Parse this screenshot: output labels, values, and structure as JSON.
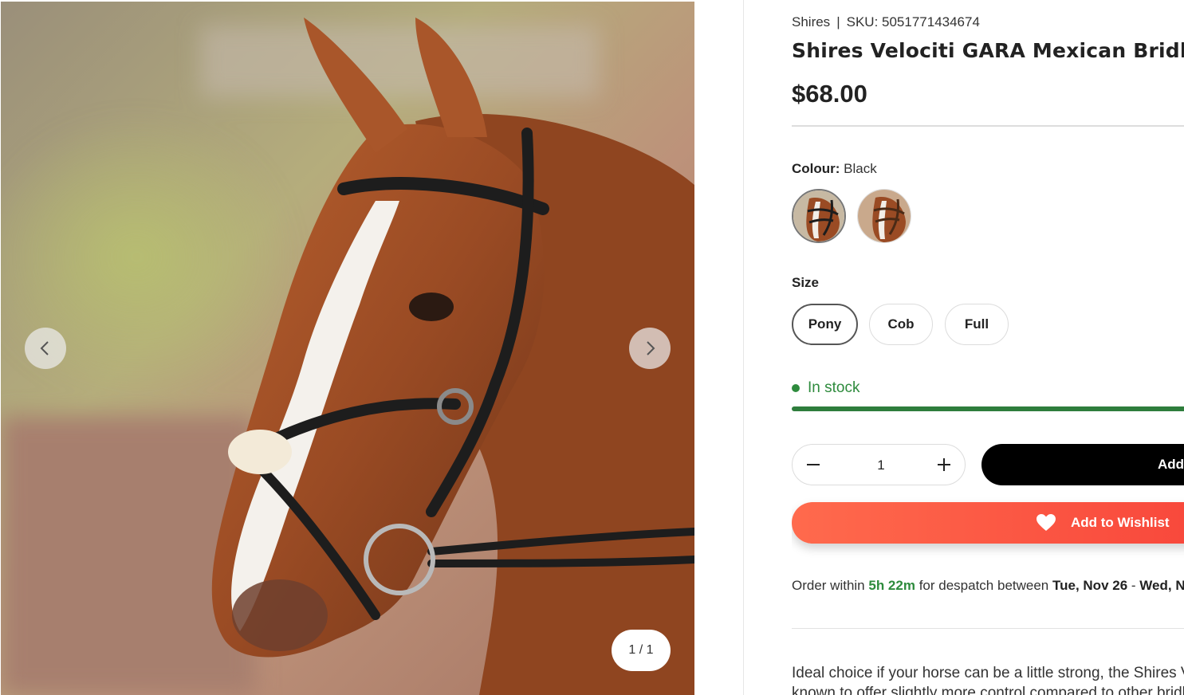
{
  "gallery": {
    "image_alt": "Chestnut horse wearing the Shires Velociti GARA Mexican Bridle",
    "counter": "1 / 1",
    "prev_icon": "chevron-left-icon",
    "next_icon": "chevron-right-icon"
  },
  "product": {
    "brand": "Shires",
    "separator": "|",
    "sku": "SKU: 5051771434674",
    "title": "Shires Velociti GARA Mexican Bridle",
    "price": "$68.00"
  },
  "colour": {
    "label": "Colour:",
    "selected": "Black",
    "swatches": [
      {
        "name": "Black",
        "selected": true
      },
      {
        "name": "Brown",
        "selected": false
      }
    ]
  },
  "size": {
    "label": "Size",
    "options": [
      "Pony",
      "Cob",
      "Full"
    ],
    "selected": "Pony"
  },
  "stock": {
    "status": "In stock",
    "level": 1.0,
    "color": "#2e8b3d"
  },
  "quantity": {
    "value": "1",
    "minus_icon": "minus-icon",
    "plus_icon": "plus-icon"
  },
  "actions": {
    "add_label": "Add",
    "wishlist_label": "Add to Wishlist",
    "wishlist_icon": "heart-icon",
    "wishlist_colors": [
      "#ff6a4d",
      "#f8473b"
    ]
  },
  "order": {
    "prefix": "Order within",
    "time": "5h 22m",
    "middle": "for despatch between",
    "date_from": "Tue, Nov 26",
    "dash": "-",
    "date_to": "Wed, No"
  },
  "description": {
    "line1": "Ideal choice if your horse can be a little strong, the Shires V",
    "line2": "known to offer slightly more control compared to other bridle"
  }
}
